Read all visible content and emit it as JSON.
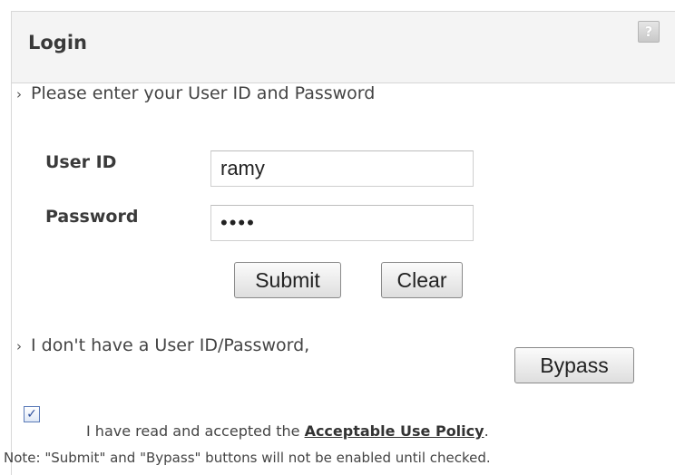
{
  "header": {
    "title": "Login",
    "help_icon": "?"
  },
  "prompt": {
    "chevron": "›",
    "text": "Please enter your User ID and Password"
  },
  "form": {
    "user_id_label": "User ID",
    "user_id_value": "ramy",
    "password_label": "Password",
    "password_value": "••••",
    "submit_label": "Submit",
    "clear_label": "Clear"
  },
  "bypass": {
    "chevron": "›",
    "text": "I don't have a User ID/Password,",
    "button_label": "Bypass"
  },
  "policy": {
    "checked": true,
    "check_mark": "✓",
    "text_before": "I have read and accepted the",
    "link_text": "Acceptable Use Policy",
    "text_after": ".",
    "note": "Note: \"Submit\" and \"Bypass\" buttons will not be enabled until checked."
  }
}
